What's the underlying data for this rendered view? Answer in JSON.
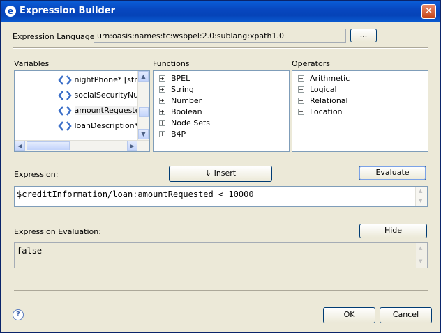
{
  "window": {
    "title": "Expression Builder",
    "close_glyph": "✕"
  },
  "language": {
    "label": "Expression Language:",
    "value": "urn:oasis:names:tc:wsbpel:2.0:sublang:xpath1.0",
    "browse_label": "..."
  },
  "variables": {
    "header": "Variables",
    "items": [
      "nightPhone* [str",
      "socialSecurityNu",
      "amountRequeste",
      "loanDescription*"
    ]
  },
  "functions": {
    "header": "Functions",
    "items": [
      "BPEL",
      "String",
      "Number",
      "Boolean",
      "Node Sets",
      "B4P"
    ]
  },
  "operators": {
    "header": "Operators",
    "items": [
      "Arithmetic",
      "Logical",
      "Relational",
      "Location"
    ]
  },
  "expression": {
    "label": "Expression:",
    "insert_label": "⇓ Insert",
    "evaluate_label": "Evaluate",
    "value": "$creditInformation/loan:amountRequested < 10000"
  },
  "evaluation": {
    "label": "Expression Evaluation:",
    "hide_label": "Hide",
    "value": "false"
  },
  "footer": {
    "help_glyph": "?",
    "ok_label": "OK",
    "cancel_label": "Cancel"
  },
  "icons": {
    "app": "expression-builder-app-icon",
    "variable": "variable-diamond-icon",
    "expand": "tree-expand-plus-icon",
    "help": "help-icon"
  },
  "colors": {
    "titlebar": "#0848c0",
    "dialog_bg": "#ece9d8",
    "close_button": "#c44418",
    "variable_icon": "#3a6ec8"
  }
}
